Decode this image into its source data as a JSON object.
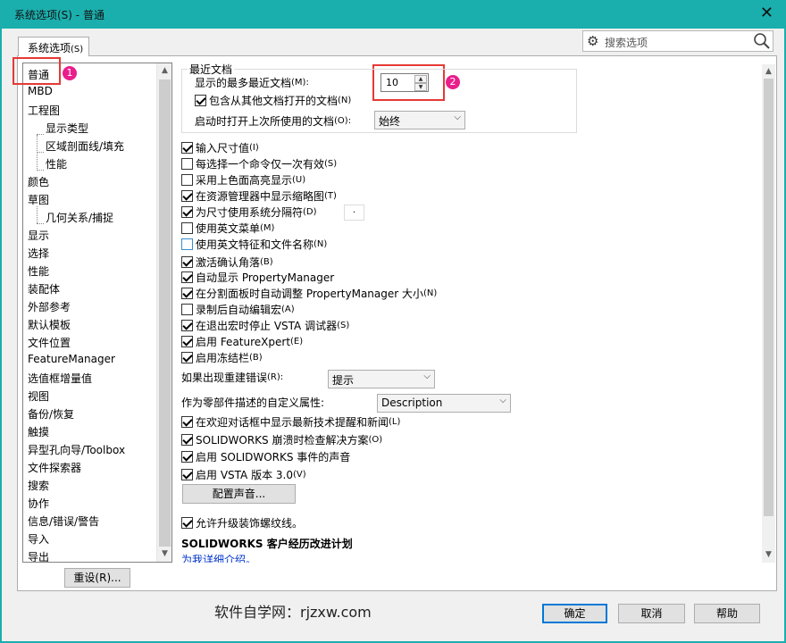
{
  "window": {
    "title": "系统选项(S) - 普通",
    "close_glyph": "✕"
  },
  "tab": {
    "label": "系统选项",
    "hotkey": "(S)"
  },
  "search": {
    "placeholder": "搜索选项"
  },
  "tree": {
    "items": [
      {
        "label": "普通",
        "level": 0
      },
      {
        "label": "MBD",
        "level": 0
      },
      {
        "label": "工程图",
        "level": 0
      },
      {
        "label": "显示类型",
        "level": 1
      },
      {
        "label": "区域剖面线/填充",
        "level": 1
      },
      {
        "label": "性能",
        "level": 1
      },
      {
        "label": "颜色",
        "level": 0
      },
      {
        "label": "草图",
        "level": 0
      },
      {
        "label": "几何关系/捕捉",
        "level": 1
      },
      {
        "label": "显示",
        "level": 0
      },
      {
        "label": "选择",
        "level": 0
      },
      {
        "label": "性能",
        "level": 0
      },
      {
        "label": "装配体",
        "level": 0
      },
      {
        "label": "外部参考",
        "level": 0
      },
      {
        "label": "默认模板",
        "level": 0
      },
      {
        "label": "文件位置",
        "level": 0
      },
      {
        "label": "FeatureManager",
        "level": 0
      },
      {
        "label": "选值框增量值",
        "level": 0
      },
      {
        "label": "视图",
        "level": 0
      },
      {
        "label": "备份/恢复",
        "level": 0
      },
      {
        "label": "触摸",
        "level": 0
      },
      {
        "label": "异型孔向导/Toolbox",
        "level": 0
      },
      {
        "label": "文件探索器",
        "level": 0
      },
      {
        "label": "搜索",
        "level": 0
      },
      {
        "label": "协作",
        "level": 0
      },
      {
        "label": "信息/错误/警告",
        "level": 0
      },
      {
        "label": "导入",
        "level": 0
      },
      {
        "label": "导出",
        "level": 0
      }
    ]
  },
  "badges": {
    "one": "1",
    "two": "2"
  },
  "reset_button": "重设(R)...",
  "recent_docs": {
    "group_label": "最近文档",
    "max_label": "显示的最多最近文档",
    "max_hotkey": "(M):",
    "max_value": "10",
    "include_other": "包含从其他文档打开的文档",
    "include_other_hotkey": "(N)",
    "open_last_label": "启动时打开上次所使用的文档",
    "open_last_hotkey": "(O):",
    "open_last_value": "始终"
  },
  "options": [
    {
      "label": "输入尺寸值",
      "hotkey": "(I)",
      "checked": true
    },
    {
      "label": "每选择一个命令仅一次有效",
      "hotkey": "(S)",
      "checked": false
    },
    {
      "label": "采用上色面高亮显示",
      "hotkey": "(U)",
      "checked": false
    },
    {
      "label": "在资源管理器中显示缩略图",
      "hotkey": "(T)",
      "checked": true
    },
    {
      "label": "为尺寸使用系统分隔符",
      "hotkey": "(D)",
      "checked": true
    },
    {
      "label": "使用英文菜单",
      "hotkey": "(M)",
      "checked": false
    },
    {
      "label": "使用英文特征和文件名称",
      "hotkey": "(N)",
      "checked": false
    },
    {
      "label": "激活确认角落",
      "hotkey": "(B)",
      "checked": true
    },
    {
      "label": "自动显示 PropertyManager",
      "hotkey": "",
      "checked": true
    },
    {
      "label": "在分割面板时自动调整 PropertyManager 大小",
      "hotkey": "(N)",
      "checked": true
    },
    {
      "label": "录制后自动编辑宏",
      "hotkey": "(A)",
      "checked": false
    },
    {
      "label": "在退出宏时停止 VSTA 调试器",
      "hotkey": "(S)",
      "checked": true
    },
    {
      "label": "启用 FeatureXpert",
      "hotkey": "(E)",
      "checked": true
    },
    {
      "label": "启用冻结栏",
      "hotkey": "(B)",
      "checked": true
    }
  ],
  "separator_value": ".",
  "rebuild_error": {
    "label": "如果出现重建错误",
    "hotkey": "(R):",
    "value": "提示"
  },
  "custom_prop": {
    "label": "作为零部件描述的自定义属性:",
    "value": "Description"
  },
  "options2": [
    {
      "label": "在欢迎对话框中显示最新技术提醒和新闻",
      "hotkey": "(L)",
      "checked": true
    },
    {
      "label": "SOLIDWORKS 崩溃时检查解决方案",
      "hotkey": "(O)",
      "checked": true
    },
    {
      "label": "启用 SOLIDWORKS 事件的声音",
      "hotkey": "",
      "checked": true
    },
    {
      "label": "启用 VSTA 版本 3.0",
      "hotkey": "(V)",
      "checked": true
    }
  ],
  "config_sound_button": "配置声音...",
  "thread_option": {
    "label": "允许升级装饰螺纹线。",
    "checked": true
  },
  "ceip": {
    "heading": "SOLIDWORKS 客户经历改进计划",
    "link": "为我详细介绍。"
  },
  "footer": {
    "watermark": "软件自学网：rjzxw.com",
    "ok": "确定",
    "cancel": "取消",
    "help": "帮助"
  }
}
